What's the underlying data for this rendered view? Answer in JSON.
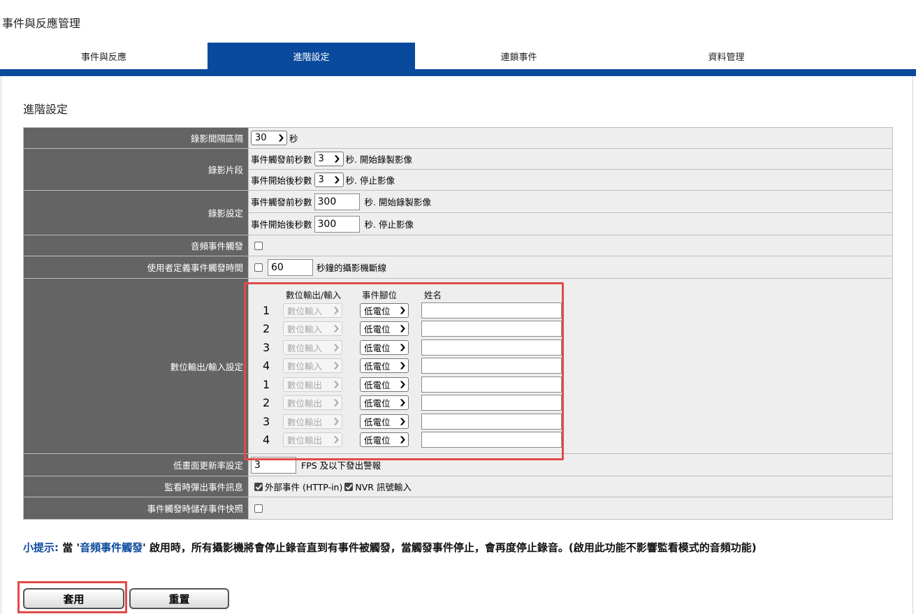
{
  "page_title": "事件與反應管理",
  "tabs": [
    {
      "label": "事件與反應",
      "active": false
    },
    {
      "label": "進階設定",
      "active": true
    },
    {
      "label": "連鎖事件",
      "active": false
    },
    {
      "label": "資料管理",
      "active": false
    }
  ],
  "section_title": "進階設定",
  "rows": {
    "record_interval": {
      "label": "錄影間隔區隔",
      "value": "30",
      "unit": "秒"
    },
    "clip": {
      "label": "錄影片段",
      "pre_label": "事件觸發前秒數",
      "pre_value": "3",
      "pre_suffix": "秒.  開始錄製影像",
      "post_label": "事件開始後秒數",
      "post_value": "3",
      "post_suffix": "秒.  停止影像"
    },
    "record_settings": {
      "label": "錄影設定",
      "pre_label": "事件觸發前秒數",
      "pre_value": "300",
      "pre_suffix": "秒.  開始錄製影像",
      "post_label": "事件開始後秒數",
      "post_value": "300",
      "post_suffix": "秒.  停止影像"
    },
    "audio_trigger": {
      "label": "音頻事件觸發",
      "checked": false
    },
    "user_defined": {
      "label": "使用者定義事件觸發時間",
      "checked": false,
      "value": "60",
      "suffix": "秒鐘的攝影機斷線"
    },
    "dio": {
      "label": "數位輸出/輸入設定",
      "headers": {
        "io": "數位輸出/輸入",
        "pin": "事件腳位",
        "name": "姓名"
      },
      "items": [
        {
          "num": "1",
          "io": "數位輸入",
          "pin": "低電位",
          "name": ""
        },
        {
          "num": "2",
          "io": "數位輸入",
          "pin": "低電位",
          "name": ""
        },
        {
          "num": "3",
          "io": "數位輸入",
          "pin": "低電位",
          "name": ""
        },
        {
          "num": "4",
          "io": "數位輸入",
          "pin": "低電位",
          "name": ""
        },
        {
          "num": "1",
          "io": "數位輸出",
          "pin": "低電位",
          "name": ""
        },
        {
          "num": "2",
          "io": "數位輸出",
          "pin": "低電位",
          "name": ""
        },
        {
          "num": "3",
          "io": "數位輸出",
          "pin": "低電位",
          "name": ""
        },
        {
          "num": "4",
          "io": "數位輸出",
          "pin": "低電位",
          "name": ""
        }
      ]
    },
    "low_fps": {
      "label": "低畫面更新率設定",
      "value": "3",
      "suffix": "FPS 及以下發出警報"
    },
    "popup": {
      "label": "監看時彈出事件訊息",
      "opt1": "外部事件 (HTTP-in)",
      "opt1_checked": true,
      "opt2": "NVR 訊號輸入",
      "opt2_checked": true
    },
    "snapshot": {
      "label": "事件觸發時儲存事件快照",
      "checked": false
    }
  },
  "tip": {
    "prefix": "小提示: ",
    "text1": "當 '",
    "highlight": "音頻事件觸發",
    "text2": "' 啟用時，所有攝影機將會停止錄音直到有事件被觸發，當觸發事件停止，會再度停止錄音。(啟用此功能不影響監看模式的音頻功能)"
  },
  "buttons": {
    "apply": "套用",
    "reset": "重置"
  }
}
